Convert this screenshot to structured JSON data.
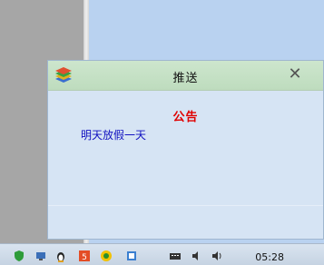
{
  "notification": {
    "title": "推送",
    "close_symbol": "✕",
    "heading": "公告",
    "message": "明天放假一天"
  },
  "taskbar": {
    "time": "05:28",
    "tray_icons": [
      "shield-icon",
      "network-icon",
      "penguin-icon",
      "html5-icon",
      "chat-icon",
      "flag-icon",
      "keyboard-icon",
      "speaker-icon",
      "volume-icon"
    ]
  },
  "colors": {
    "heading": "#e00000",
    "message": "#1010c0",
    "titlebar": "#c6e0c6",
    "window_body": "#d6e4f4"
  }
}
